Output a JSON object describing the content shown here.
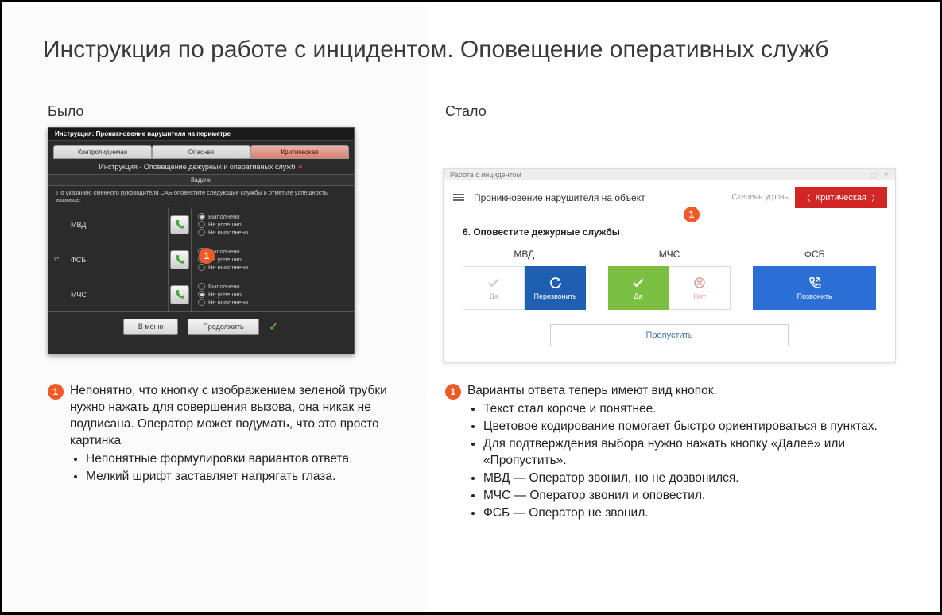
{
  "title": "Инструкция по работе с инцидентом. Оповещение оперативных служб",
  "labels": {
    "before": "Было",
    "after": "Стало"
  },
  "before_mock": {
    "window_title": "Инструкция: Проникновение нарушителя на периметре",
    "tabs": {
      "controlled": "Контролируемая",
      "dangerous": "Опасная",
      "critical": "Критическая"
    },
    "subtitle": "Инструкция - Оповещение дежурных и оперативных служб",
    "tasks_header": "Задачи",
    "task_desc": "По указанию сменного руководителя САБ оповестите следующие службы и отметьте успешность вызовов:",
    "radio": {
      "done": "Выполнено",
      "fail": "Не успешно",
      "not_done": "Не выполнено"
    },
    "rows": [
      {
        "prefix": "",
        "name": "МВД",
        "selected": 0
      },
      {
        "prefix": "1*",
        "name": "ФСБ",
        "selected": 1
      },
      {
        "prefix": "",
        "name": "МЧС",
        "selected": 1
      }
    ],
    "buttons": {
      "menu": "В меню",
      "continue": "Продолжить"
    },
    "badge": "1"
  },
  "after_mock": {
    "app_title": "Работа с инцидентом",
    "header_title": "Проникновение нарушителя на объект",
    "threat_label": "Степень угрозы",
    "threat_value": "Критическая",
    "step_title": "6. Оповестите дежурные службы",
    "services": {
      "mvd": {
        "name": "МВД",
        "yes": "Да",
        "retry": "Перезвонить"
      },
      "mchs": {
        "name": "МЧС",
        "yes": "Да",
        "no": "Нет"
      },
      "fsb": {
        "name": "ФСБ",
        "call": "Позвонить"
      }
    },
    "skip": "Пропустить",
    "badge": "1"
  },
  "notes_before": {
    "badge": "1",
    "first": "Непонятно, что кнопку с изображением зеленой трубки нужно нажать для совершения вызова, она никак не подписана. Оператор может подумать, что это просто картинка",
    "bullets": [
      "Непонятные формулировки вариантов ответа.",
      "Мелкий шрифт заставляет напрягать глаза."
    ]
  },
  "notes_after": {
    "badge": "1",
    "first": "Варианты ответа теперь имеют вид кнопок.",
    "bullets": [
      "Текст стал короче и понятнее.",
      "Цветовое кодирование помогает быстро ориентироваться в пунктах.",
      "Для подтверждения выбора нужно нажать кнопку «Далее» или «Пропустить».",
      "МВД — Оператор звонил, но не дозвонился.",
      "МЧС — Оператор звонил и оповестил.",
      "ФСБ — Оператор не звонил."
    ]
  }
}
